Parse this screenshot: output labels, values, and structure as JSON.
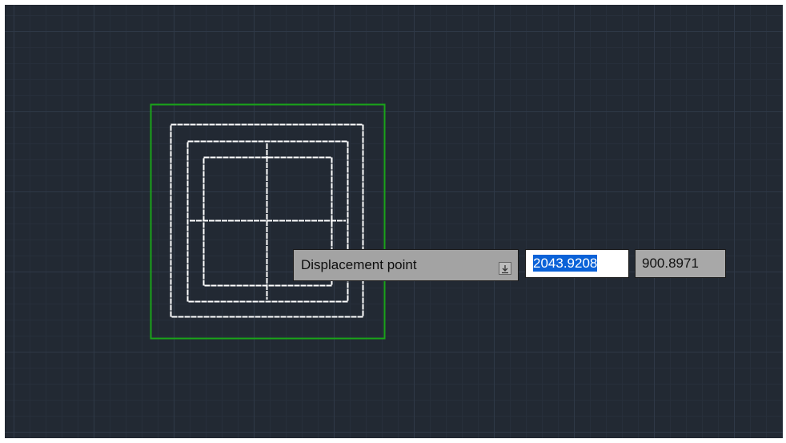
{
  "dynamic_input": {
    "prompt_label": "Displacement point",
    "menu_icon": "down-arrow-menu-icon",
    "x_value": "2043.9208",
    "y_value": "900.8971"
  },
  "colors": {
    "canvas_background": "#222933",
    "selection_boundary": "#1aa31a",
    "drawing_lines": "#ffffff",
    "input_highlight": "#0a62d8"
  }
}
